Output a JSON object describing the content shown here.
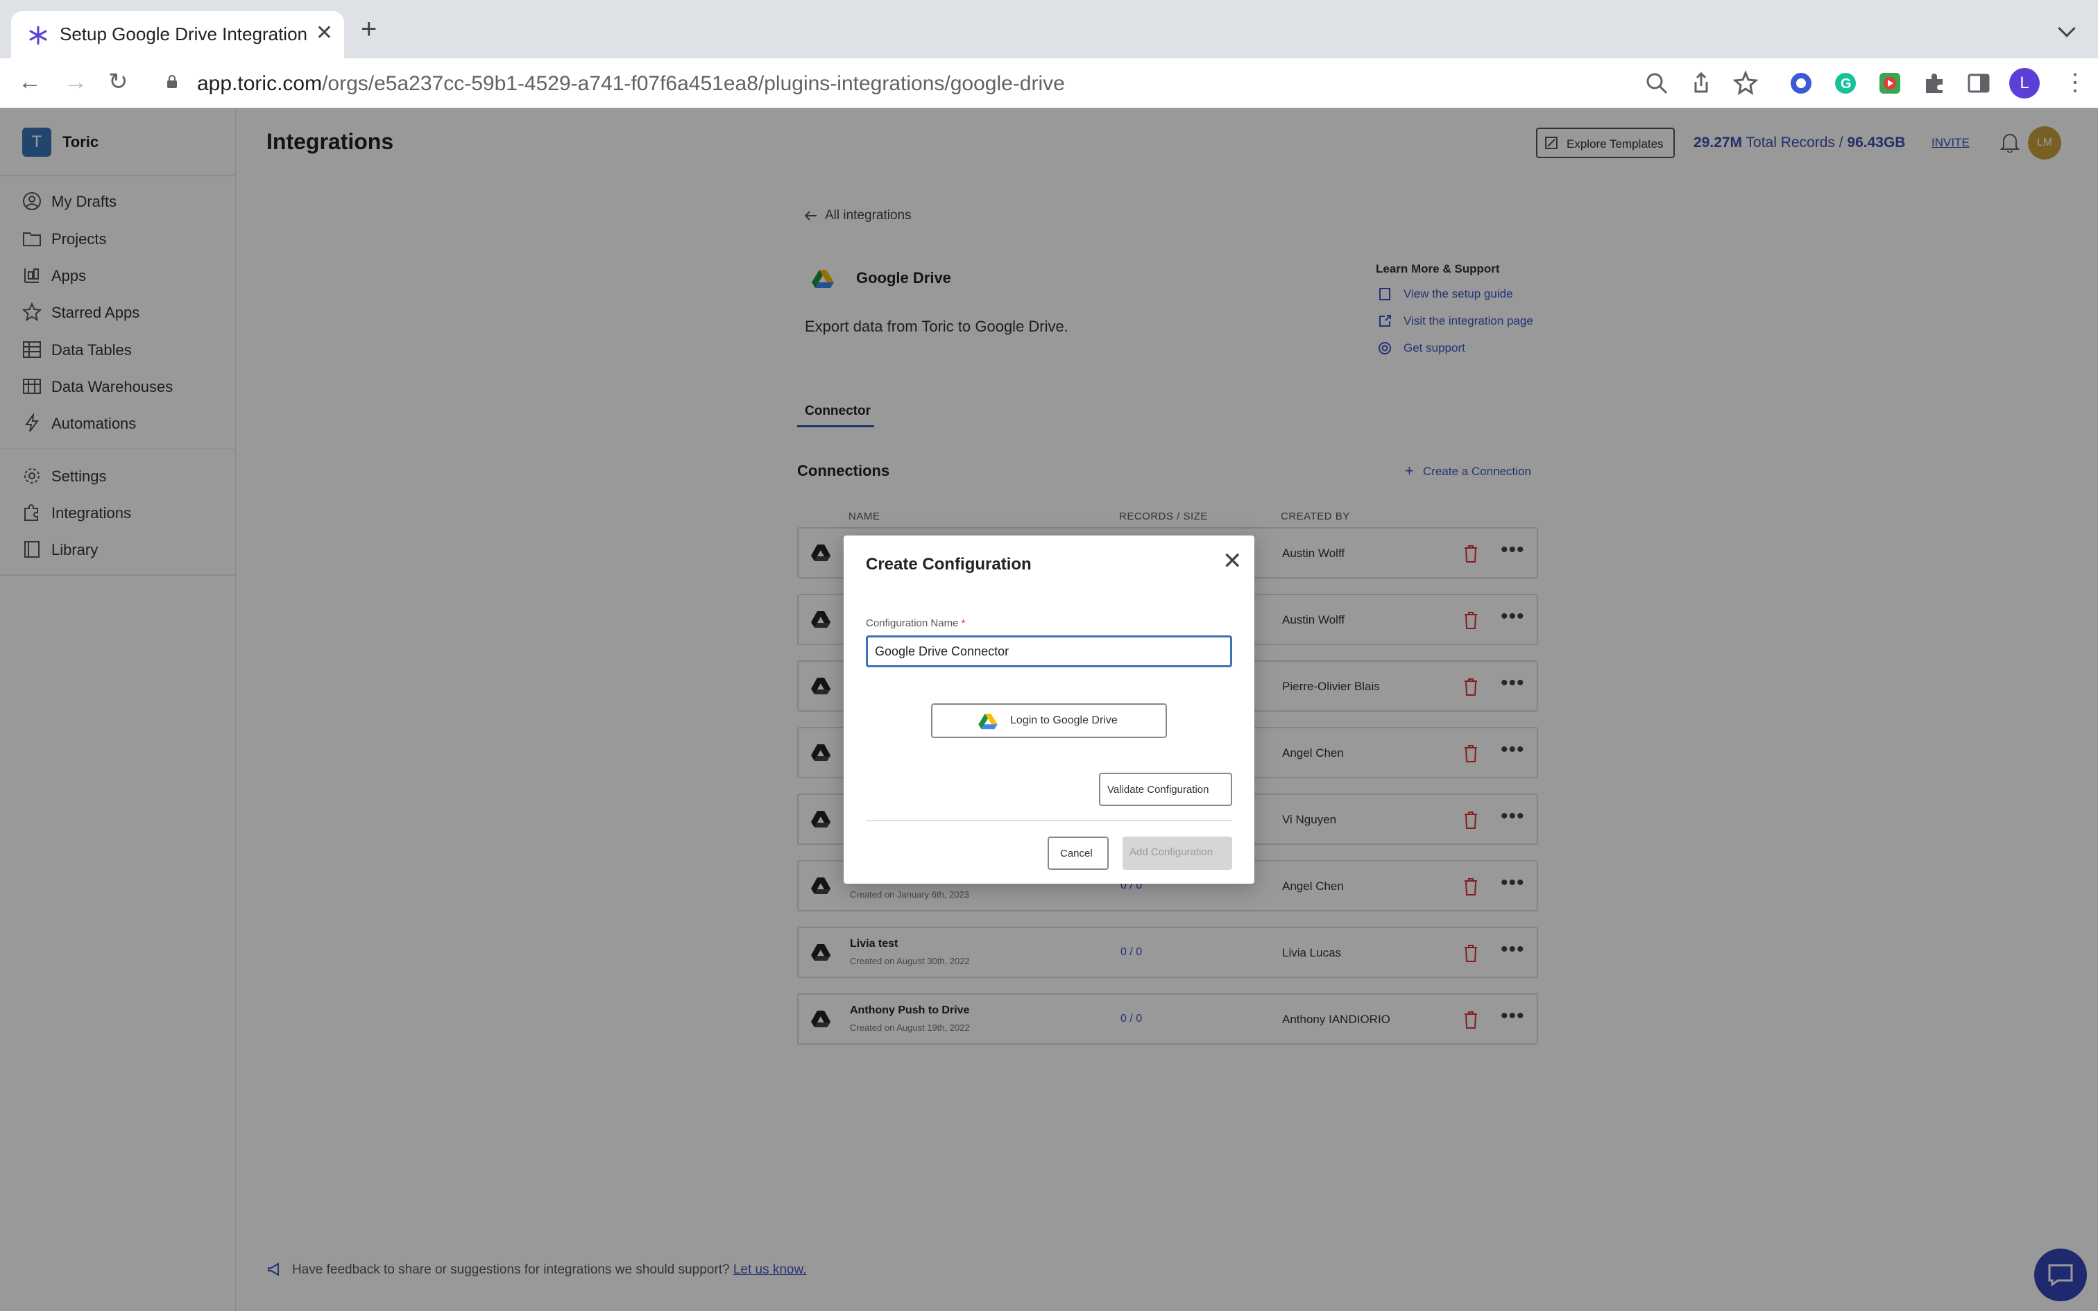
{
  "browser": {
    "tab_title": "Setup Google Drive Integration",
    "url_host": "app.toric.com",
    "url_path": "/orgs/e5a237cc-59b1-4529-a741-f07f6a451ea8/plugins-integrations/google-drive",
    "profile_initial": "L"
  },
  "sidebar": {
    "org_initial": "T",
    "org_name": "Toric",
    "items": [
      {
        "label": "My Drafts",
        "icon": "person-icon"
      },
      {
        "label": "Projects",
        "icon": "folder-icon"
      },
      {
        "label": "Apps",
        "icon": "apps-icon"
      },
      {
        "label": "Starred Apps",
        "icon": "star-icon"
      },
      {
        "label": "Data Tables",
        "icon": "table-icon"
      },
      {
        "label": "Data Warehouses",
        "icon": "warehouse-icon"
      },
      {
        "label": "Automations",
        "icon": "bolt-icon"
      },
      {
        "label": "Settings",
        "icon": "gear-icon"
      },
      {
        "label": "Integrations",
        "icon": "puzzle-icon"
      },
      {
        "label": "Library",
        "icon": "book-icon"
      }
    ]
  },
  "header": {
    "title": "Integrations",
    "explore_label": "Explore Templates",
    "records_count": "29.27M",
    "records_label": "Total Records /",
    "records_size": "96.43GB",
    "invite_label": "INVITE",
    "avatar_initials": "LM"
  },
  "integration": {
    "back_label": "All integrations",
    "name": "Google Drive",
    "description": "Export data from Toric to Google Drive.",
    "support_title": "Learn More & Support",
    "support_links": [
      "View the setup guide",
      "Visit the integration page",
      "Get support"
    ],
    "tab_label": "Connector"
  },
  "connections": {
    "title": "Connections",
    "create_label": "Create a Connection",
    "columns": {
      "name": "NAME",
      "records": "RECORDS / SIZE",
      "created_by": "CREATED BY"
    },
    "rows": [
      {
        "name": "",
        "date": "",
        "size": "",
        "owner": "Austin Wolff"
      },
      {
        "name": "",
        "date": "",
        "size": "",
        "owner": "Austin Wolff"
      },
      {
        "name": "",
        "date": "",
        "size": "",
        "owner": "Pierre-Olivier Blais"
      },
      {
        "name": "",
        "date": "",
        "size": "",
        "owner": "Angel Chen"
      },
      {
        "name": "",
        "date": "",
        "size": "",
        "owner": "Vi Nguyen"
      },
      {
        "name": "",
        "date": "Created on January 6th, 2023",
        "size": "0 / 0",
        "owner": "Angel Chen"
      },
      {
        "name": "Livia test",
        "date": "Created on August 30th, 2022",
        "size": "0 / 0",
        "owner": "Livia Lucas"
      },
      {
        "name": "Anthony Push to Drive",
        "date": "Created on August 19th, 2022",
        "size": "0 / 0",
        "owner": "Anthony IANDIORIO"
      }
    ]
  },
  "feedback": {
    "text": "Have feedback to share or suggestions for integrations we should support?",
    "link": "Let us know."
  },
  "modal": {
    "title": "Create Configuration",
    "field_label": "Configuration Name",
    "required_mark": "*",
    "field_value": "Google Drive Connector",
    "login_label": "Login to Google Drive",
    "validate_label": "Validate Configuration",
    "cancel_label": "Cancel",
    "add_label": "Add Configuration"
  }
}
